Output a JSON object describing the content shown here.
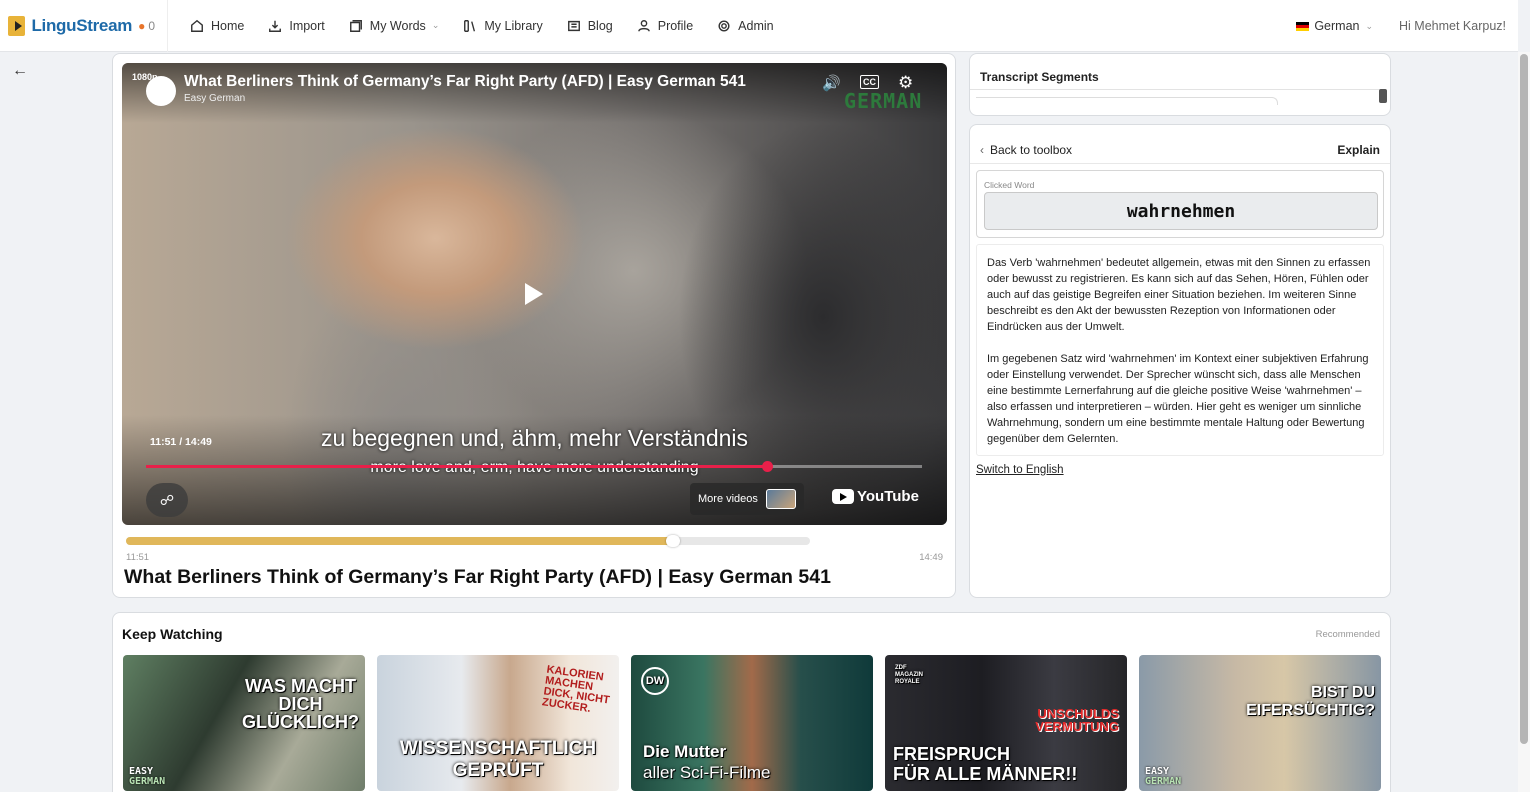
{
  "nav": {
    "brand": "LinguStream",
    "streak_count": "0",
    "items": [
      {
        "label": "Home",
        "icon": "home-icon"
      },
      {
        "label": "Import",
        "icon": "import-icon"
      },
      {
        "label": "My Words",
        "icon": "words-icon",
        "dropdown": true
      },
      {
        "label": "My Library",
        "icon": "library-icon"
      },
      {
        "label": "Blog",
        "icon": "blog-icon"
      },
      {
        "label": "Profile",
        "icon": "profile-icon"
      },
      {
        "label": "Admin",
        "icon": "admin-icon"
      }
    ],
    "language": "German",
    "greeting": "Hi Mehmet Karpuz!"
  },
  "player": {
    "resolution": "1080p",
    "title": "What Berliners Think of Germany’s Far Right Party (AFD) | Easy German 541",
    "channel": "Easy German",
    "watermark": "GERMAN",
    "cc_label": "CC",
    "time_display": "11:51 / 14:49",
    "subtitle_de": "zu begegnen und, ähm, mehr Verständnis",
    "subtitle_en": "more love and, erm, have more understanding",
    "progress_fraction": 0.8,
    "more_videos": "More videos",
    "youtube": "YouTube"
  },
  "video": {
    "progress_fraction": 0.8,
    "current_time": "11:51",
    "duration": "14:49",
    "title": "What Berliners Think of Germany’s Far Right Party (AFD) | Easy German 541"
  },
  "transcript": {
    "title": "Transcript Segments"
  },
  "explain": {
    "back_label": "Back to toolbox",
    "mode_label": "Explain",
    "clicked_word_label": "Clicked Word",
    "clicked_word": "wahrnehmen",
    "paragraphs": [
      "Das Verb 'wahrnehmen' bedeutet allgemein, etwas mit den Sinnen zu erfassen oder bewusst zu registrieren. Es kann sich auf das Sehen, Hören, Fühlen oder auch auf das geistige Begreifen einer Situation beziehen. Im weiteren Sinne beschreibt es den Akt der bewussten Rezeption von Informationen oder Eindrücken aus der Umwelt.",
      "Im gegebenen Satz wird 'wahrnehmen' im Kontext einer subjektiven Erfahrung oder Einstellung verwendet. Der Sprecher wünscht sich, dass alle Menschen eine bestimmte Lernerfahrung auf die gleiche positive Weise 'wahrnehmen' – also erfassen und interpretieren – würden. Hier geht es weniger um sinnliche Wahrnehmung, sondern um eine bestimmte mentale Haltung oder Bewertung gegenüber dem Gelernten."
    ],
    "switch_label": "Switch to English"
  },
  "keep_watching": {
    "title": "Keep Watching",
    "recommended": "Recommended",
    "thumbs": [
      {
        "text_lines": [
          "WAS MACHT",
          "DICH",
          "GLÜCKLICH?"
        ],
        "logo_top": "EASY",
        "logo_bottom": "GERMAN"
      },
      {
        "text_lines": [
          "WISSENSCHAFTLICH",
          "GEPRÜFT"
        ],
        "tag_lines": [
          "KALORIEN",
          "MACHEN",
          "DICK, NICHT",
          "ZUCKER."
        ]
      },
      {
        "text_lines": [
          "Die Mutter",
          "aller Sci-Fi-Filme"
        ],
        "badge": "DW"
      },
      {
        "text_lines": [
          "FREISPRUCH",
          "FÜR ALLE MÄNNER!!"
        ],
        "tag_lines": [
          "UNSCHULDS",
          "VERMUTUNG"
        ],
        "badge": "ZDF MAGAZIN ROYALE"
      },
      {
        "text_lines": [
          "BIST DU",
          "EIFERSÜCHTIG?"
        ],
        "logo_top": "EASY",
        "logo_bottom": "GERMAN"
      }
    ]
  }
}
